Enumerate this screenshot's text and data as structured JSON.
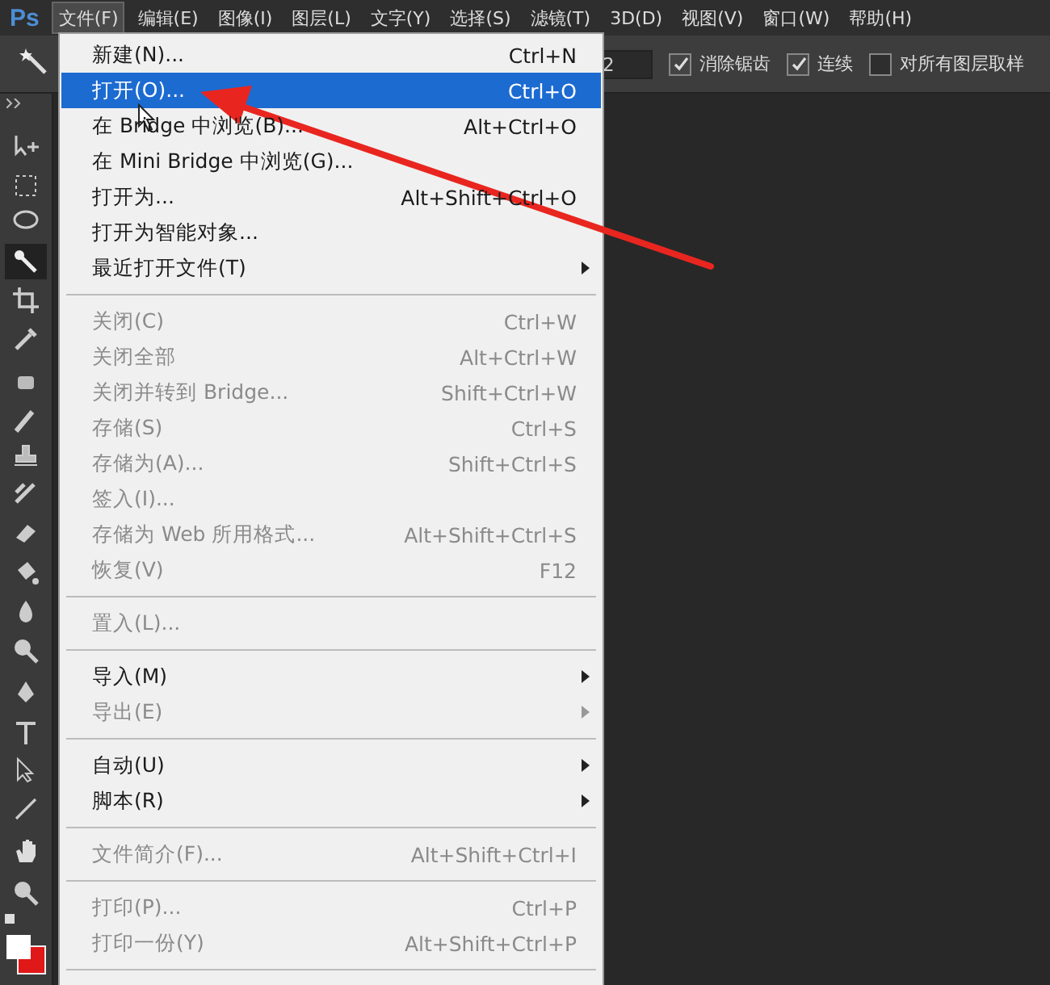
{
  "app": {
    "logo": "Ps"
  },
  "menu_bar": [
    {
      "label": "文件(F)",
      "selected": true
    },
    {
      "label": "编辑(E)",
      "selected": false
    },
    {
      "label": "图像(I)",
      "selected": false
    },
    {
      "label": "图层(L)",
      "selected": false
    },
    {
      "label": "文字(Y)",
      "selected": false
    },
    {
      "label": "选择(S)",
      "selected": false
    },
    {
      "label": "滤镜(T)",
      "selected": false
    },
    {
      "label": "3D(D)",
      "selected": false
    },
    {
      "label": "视图(V)",
      "selected": false
    },
    {
      "label": "窗口(W)",
      "selected": false
    },
    {
      "label": "帮助(H)",
      "selected": false
    }
  ],
  "options_bar": {
    "tolerance_value": "2",
    "checkboxes": [
      {
        "label": "消除锯齿",
        "checked": true
      },
      {
        "label": "连续",
        "checked": true
      },
      {
        "label": "对所有图层取样",
        "checked": false
      }
    ]
  },
  "tools": [
    {
      "selected": false
    },
    {
      "selected": false
    },
    {
      "selected": false
    },
    {
      "selected": true
    },
    {
      "selected": false
    },
    {
      "selected": false
    },
    {
      "selected": false
    },
    {
      "selected": false
    },
    {
      "selected": false
    },
    {
      "selected": false
    },
    {
      "selected": false
    },
    {
      "selected": false
    },
    {
      "selected": false
    },
    {
      "selected": false
    },
    {
      "selected": false
    },
    {
      "selected": false
    },
    {
      "selected": false
    },
    {
      "selected": false
    },
    {
      "selected": false
    }
  ],
  "file_menu": [
    {
      "kind": "item",
      "label": "新建(N)...",
      "shortcut": "Ctrl+N",
      "disabled": false,
      "selected": false
    },
    {
      "kind": "item",
      "label": "打开(O)...",
      "shortcut": "Ctrl+O",
      "disabled": false,
      "selected": true
    },
    {
      "kind": "item",
      "label": "在 Bridge 中浏览(B)...",
      "shortcut": "Alt+Ctrl+O",
      "disabled": false,
      "selected": false
    },
    {
      "kind": "item",
      "label": "在 Mini Bridge 中浏览(G)...",
      "disabled": false,
      "selected": false
    },
    {
      "kind": "item",
      "label": "打开为...",
      "shortcut": "Alt+Shift+Ctrl+O",
      "disabled": false,
      "selected": false
    },
    {
      "kind": "item",
      "label": "打开为智能对象...",
      "disabled": false,
      "selected": false
    },
    {
      "kind": "submenu",
      "label": "最近打开文件(T)",
      "disabled": false,
      "selected": false
    },
    {
      "kind": "separator"
    },
    {
      "kind": "item",
      "label": "关闭(C)",
      "shortcut": "Ctrl+W",
      "disabled": true,
      "selected": false
    },
    {
      "kind": "item",
      "label": "关闭全部",
      "shortcut": "Alt+Ctrl+W",
      "disabled": true,
      "selected": false
    },
    {
      "kind": "item",
      "label": "关闭并转到 Bridge...",
      "shortcut": "Shift+Ctrl+W",
      "disabled": true,
      "selected": false
    },
    {
      "kind": "item",
      "label": "存储(S)",
      "shortcut": "Ctrl+S",
      "disabled": true,
      "selected": false
    },
    {
      "kind": "item",
      "label": "存储为(A)...",
      "shortcut": "Shift+Ctrl+S",
      "disabled": true,
      "selected": false
    },
    {
      "kind": "item",
      "label": "签入(I)...",
      "disabled": true,
      "selected": false
    },
    {
      "kind": "item",
      "label": "存储为 Web 所用格式...",
      "shortcut": "Alt+Shift+Ctrl+S",
      "disabled": true,
      "selected": false
    },
    {
      "kind": "item",
      "label": "恢复(V)",
      "shortcut": "F12",
      "disabled": true,
      "selected": false
    },
    {
      "kind": "separator"
    },
    {
      "kind": "item",
      "label": "置入(L)...",
      "disabled": true,
      "selected": false
    },
    {
      "kind": "separator"
    },
    {
      "kind": "submenu",
      "label": "导入(M)",
      "disabled": false,
      "selected": false
    },
    {
      "kind": "submenu",
      "label": "导出(E)",
      "disabled": true,
      "selected": false
    },
    {
      "kind": "separator"
    },
    {
      "kind": "submenu",
      "label": "自动(U)",
      "disabled": false,
      "selected": false
    },
    {
      "kind": "submenu",
      "label": "脚本(R)",
      "disabled": false,
      "selected": false
    },
    {
      "kind": "separator"
    },
    {
      "kind": "item",
      "label": "文件简介(F)...",
      "shortcut": "Alt+Shift+Ctrl+I",
      "disabled": true,
      "selected": false
    },
    {
      "kind": "separator"
    },
    {
      "kind": "item",
      "label": "打印(P)...",
      "shortcut": "Ctrl+P",
      "disabled": true,
      "selected": false
    },
    {
      "kind": "item",
      "label": "打印一份(Y)",
      "shortcut": "Alt+Shift+Ctrl+P",
      "disabled": true,
      "selected": false
    },
    {
      "kind": "separator"
    }
  ]
}
